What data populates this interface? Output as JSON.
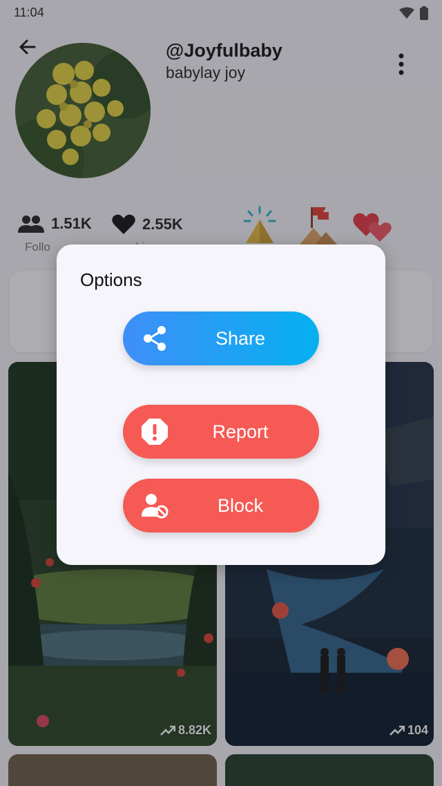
{
  "status_bar": {
    "time": "11:04"
  },
  "profile": {
    "username": "@Joyfulbaby",
    "display_name": "babylay joy",
    "followers": "1.51K",
    "likes": "2.55K",
    "followers_caption": "Follo",
    "likes_caption": "Li"
  },
  "posts": [
    {
      "stat": "8.82K"
    },
    {
      "stat": "104"
    }
  ],
  "dialog": {
    "title": "Options",
    "share_label": "Share",
    "report_label": "Report",
    "block_label": "Block"
  },
  "colors": {
    "share_gradient_start": "#3f8ef8",
    "share_gradient_end": "#05b1ef",
    "danger": "#f55a55"
  }
}
